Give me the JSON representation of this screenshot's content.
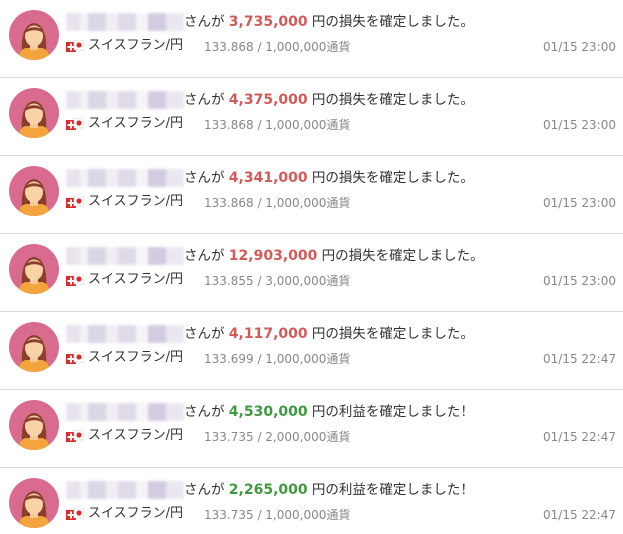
{
  "feed": {
    "items": [
      {
        "action": "さんが ",
        "amount": "3,735,000",
        "suffix": " 円の損失を確定しました。",
        "type": "loss",
        "pair": "スイスフラン/円",
        "price": "133.868 / 1,000,000通貨",
        "time": "01/15 23:00"
      },
      {
        "action": "さんが ",
        "amount": "4,375,000",
        "suffix": " 円の損失を確定しました。",
        "type": "loss",
        "pair": "スイスフラン/円",
        "price": "133.868 / 1,000,000通貨",
        "time": "01/15 23:00"
      },
      {
        "action": "さんが ",
        "amount": "4,341,000",
        "suffix": " 円の損失を確定しました。",
        "type": "loss",
        "pair": "スイスフラン/円",
        "price": "133.868 / 1,000,000通貨",
        "time": "01/15 23:00"
      },
      {
        "action": "さんが ",
        "amount": "12,903,000",
        "suffix": " 円の損失を確定しました。",
        "type": "loss",
        "pair": "スイスフラン/円",
        "price": "133.855 / 3,000,000通貨",
        "time": "01/15 23:00"
      },
      {
        "action": "さんが ",
        "amount": "4,117,000",
        "suffix": " 円の損失を確定しました。",
        "type": "loss",
        "pair": "スイスフラン/円",
        "price": "133.699 / 1,000,000通貨",
        "time": "01/15 22:47"
      },
      {
        "action": "さんが ",
        "amount": "4,530,000",
        "suffix": " 円の利益を確定しました！",
        "type": "profit",
        "pair": "スイスフラン/円",
        "price": "133.735 / 2,000,000通貨",
        "time": "01/15 22:47"
      },
      {
        "action": "さんが ",
        "amount": "2,265,000",
        "suffix": " 円の利益を確定しました！",
        "type": "profit",
        "pair": "スイスフラン/円",
        "price": "133.735 / 1,000,000通貨",
        "time": "01/15 22:47"
      }
    ]
  },
  "colors": {
    "loss": "#d45a5a",
    "profit": "#3f9a3f",
    "avatar_bg": "#d96b8e"
  },
  "icons": {
    "avatar": "user-avatar-icon",
    "pair": "swiss-yen-flag-icon"
  }
}
